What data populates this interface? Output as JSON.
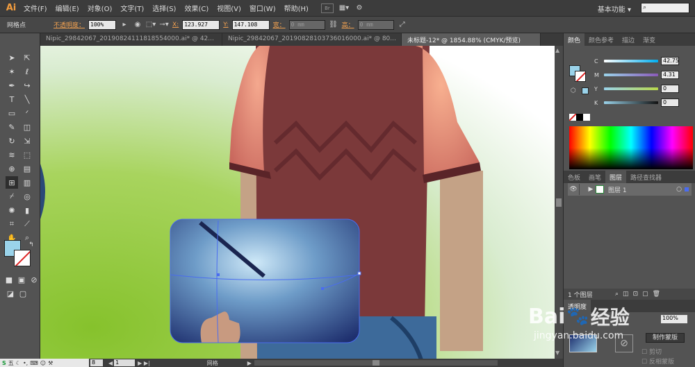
{
  "menubar": {
    "logo": "Ai",
    "items": [
      "文件(F)",
      "编辑(E)",
      "对象(O)",
      "文字(T)",
      "选择(S)",
      "效果(C)",
      "视图(V)",
      "窗口(W)",
      "帮助(H)"
    ],
    "bridge_label": "Br",
    "workspace": "基本功能"
  },
  "control": {
    "selection_label": "网格点",
    "opacity_label": "不透明度：",
    "opacity_value": "100%",
    "x_label": "X:",
    "x_value": "123.927",
    "y_label": "Y:",
    "y_value": "147.108",
    "w_label": "宽：",
    "w_value": "0 mm",
    "h_label": "高：",
    "h_value": "0 mm"
  },
  "tabs": [
    {
      "label": "Nipic_29842067_20190824111818554000.ai* @ 42..."
    },
    {
      "label": "Nipic_29842067_20190828103736016000.ai* @ 80..."
    },
    {
      "label": "未标题-12* @ 1854.88% (CMYK/预览)"
    }
  ],
  "color_panel": {
    "tabs": [
      "颜色",
      "颜色参考",
      "描边",
      "渐变"
    ],
    "channels": [
      {
        "name": "C",
        "value": "42.75"
      },
      {
        "name": "M",
        "value": "4.31"
      },
      {
        "name": "Y",
        "value": "0"
      },
      {
        "name": "K",
        "value": "0"
      }
    ],
    "fill_color": "#9ad3ea"
  },
  "layers_panel": {
    "tabs": [
      "色板",
      "画笔",
      "图层",
      "路径查找器"
    ],
    "layer_name": "图层 1",
    "footer_count": "1 个图层"
  },
  "transparency_panel": {
    "tab": "透明度",
    "opacity_value": "100%",
    "make_mask_label": "制作蒙版",
    "clip_label": "剪切",
    "invert_label": "反相蒙版"
  },
  "statusbar": {
    "zoom": "8",
    "page": "1",
    "tool_label": "网格"
  },
  "watermark": {
    "brand": "Bai",
    "brand2": "经验",
    "url": "jingyan.baidu.com"
  },
  "ime": {
    "label": "五"
  }
}
